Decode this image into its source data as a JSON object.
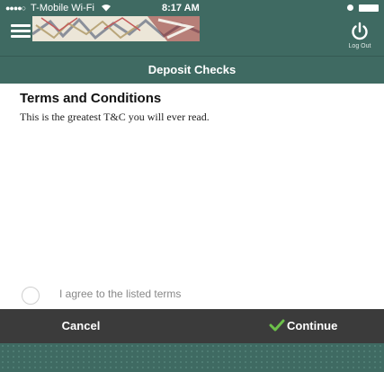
{
  "status_bar": {
    "carrier": "T-Mobile Wi-Fi",
    "time": "8:17 AM"
  },
  "header": {
    "logout_label": "Log Out"
  },
  "title": "Deposit Checks",
  "terms": {
    "heading": "Terms and Conditions",
    "body": "This is the greatest T&C you will ever read."
  },
  "agree": {
    "label": "I agree to the listed terms",
    "checked": false
  },
  "actions": {
    "cancel_label": "Cancel",
    "continue_label": "Continue"
  },
  "colors": {
    "brand": "#3f6a62",
    "action_bar": "#3b3b3b",
    "accent_check": "#6cc04a"
  }
}
